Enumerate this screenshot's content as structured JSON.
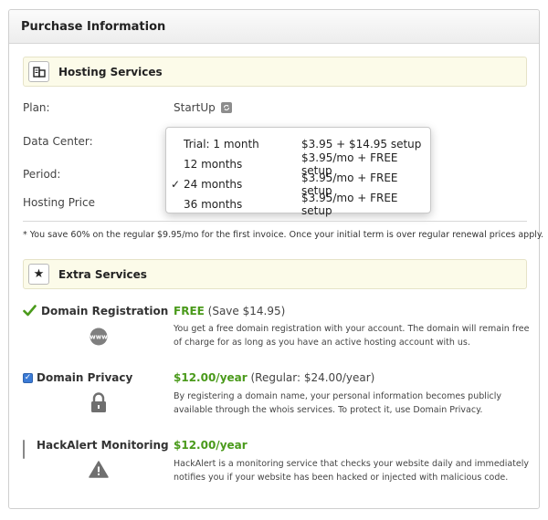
{
  "panel": {
    "title": "Purchase Information"
  },
  "hosting": {
    "title": "Hosting Services",
    "icon": "server-icon",
    "rows": {
      "plan_label": "Plan:",
      "plan_value": "StartUp",
      "datacenter_label": "Data Center:",
      "period_label": "Period:",
      "price_label": "Hosting Price"
    },
    "period_options": [
      {
        "term": "Trial: 1 month",
        "price": "$3.95 + $14.95 setup",
        "selected": false
      },
      {
        "term": "12 months",
        "price": "$3.95/mo + FREE setup",
        "selected": false
      },
      {
        "term": "24 months",
        "price": "$3.95/mo + FREE setup",
        "selected": true
      },
      {
        "term": "36 months",
        "price": "$3.95/mo + FREE setup",
        "selected": false
      }
    ],
    "check_mark": "✓",
    "note": "* You save 60% on the regular $9.95/mo for the first invoice. Once your initial term is over regular renewal prices apply."
  },
  "extras": {
    "title": "Extra Services",
    "icon": "star-icon",
    "items": [
      {
        "name": "Domain Registration",
        "price": "FREE",
        "sub": " (Save $14.95)",
        "desc": "You get a free domain registration with your account. The domain will remain free of charge for as long as you have an active hosting account with us.",
        "symbol": "www-icon",
        "symbol_text": "www",
        "state": "included"
      },
      {
        "name": "Domain Privacy",
        "price": "$12.00/year",
        "sub": "  (Regular: $24.00/year)",
        "desc": "By registering a domain name, your personal information becomes publicly available through the whois services. To protect it, use Domain Privacy.",
        "symbol": "lock-icon",
        "state": "checked"
      },
      {
        "name": "HackAlert Monitoring",
        "price": "$12.00/year",
        "sub": "",
        "desc": "HackAlert is a monitoring service that checks your website daily and immediately notifies you if your website has been hacked or injected with malicious code.",
        "symbol": "warning-icon",
        "state": "unchecked"
      }
    ]
  },
  "colors": {
    "accent_green": "#4a9a1b",
    "checkbox_blue": "#3b7bd6",
    "section_bar_bg": "#fcfbe9"
  }
}
